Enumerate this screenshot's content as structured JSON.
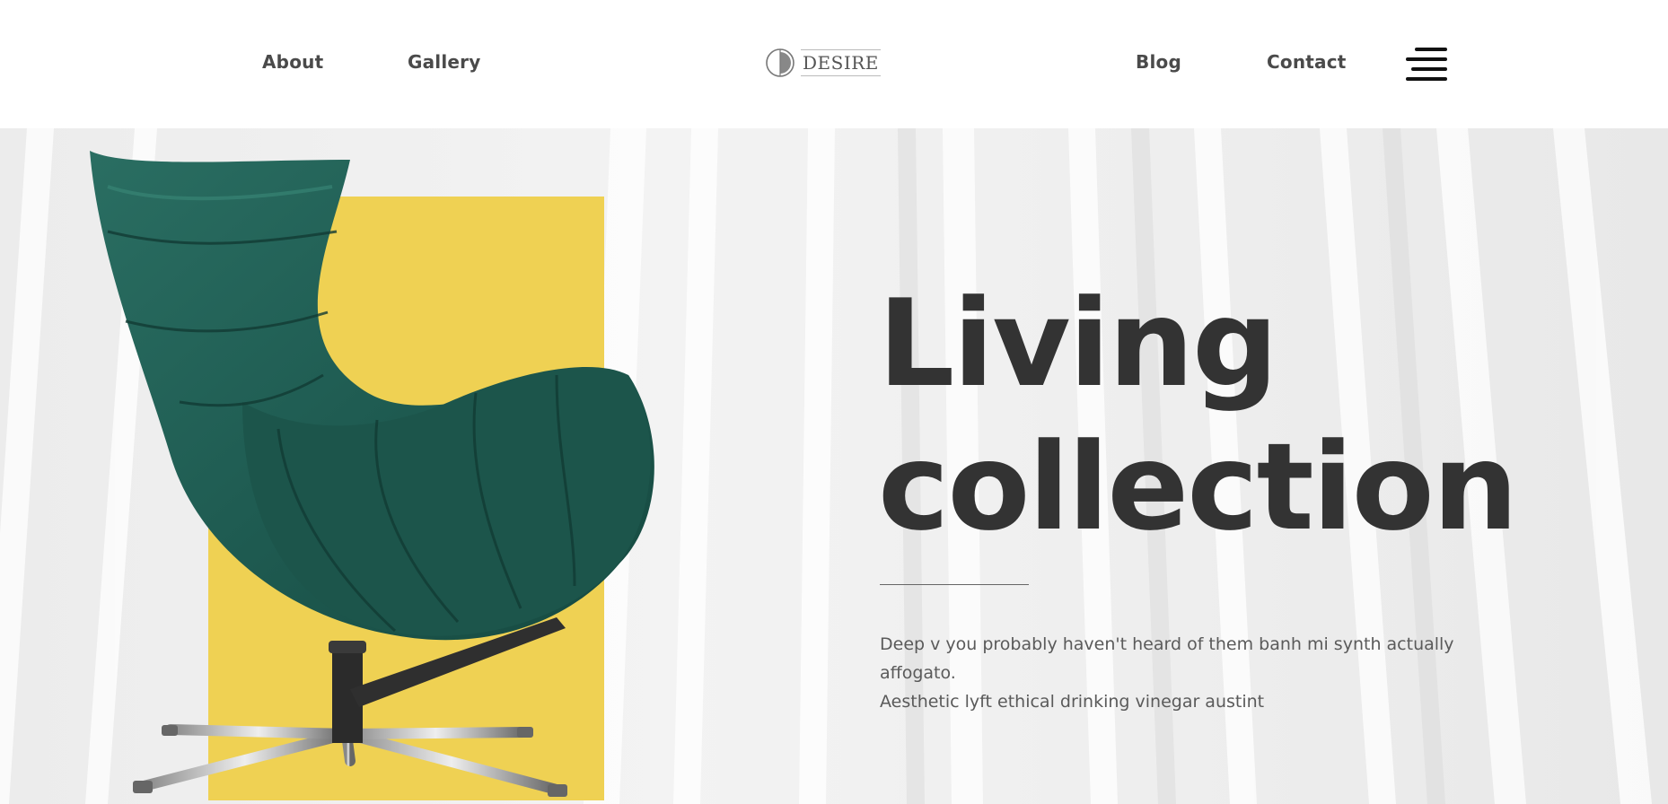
{
  "header": {
    "nav_left": [
      "About",
      "Gallery"
    ],
    "nav_right": [
      "Blog",
      "Contact"
    ],
    "logo_text": "DESIRE",
    "menu_icon": "hamburger-menu-icon"
  },
  "hero": {
    "title_line1": "Living",
    "title_line2": "collection",
    "description_line1": "Deep v you probably haven't heard of them banh mi synth actually affogato.",
    "description_line2": "Aesthetic lyft ethical drinking vinegar austint",
    "image": "green-lounge-chair",
    "accent_color": "#efd153",
    "chair_color": "#1f5c52"
  }
}
